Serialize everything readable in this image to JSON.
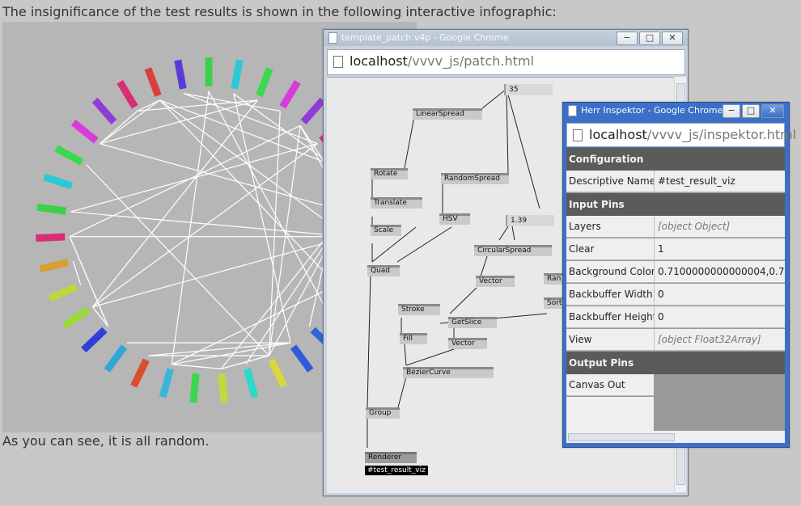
{
  "page": {
    "intro_text": "The insignificance of the test results is shown in the following interactive infographic:",
    "outro_text": "As you can see, it is all random."
  },
  "colors": {
    "page_bg": "#c8c8c8",
    "infographic_bg": "#b6b6b6",
    "bar_colors": [
      "#3cd14a",
      "#2bc8d8",
      "#3bd94c",
      "#d83bd8",
      "#8f3bd8",
      "#d82e79",
      "#d84040",
      "#5a3bd8",
      "#d8cf3b",
      "#d82e6b",
      "#2f3dd8",
      "#2ed8c8",
      "#2fd8c8",
      "#2f67d8",
      "#2f5bd8",
      "#d8d83b",
      "#2fd8c8",
      "#c3d83b",
      "#3bd84f",
      "#3bb6d8",
      "#d84f2f",
      "#2fa7d8",
      "#2f3fd8",
      "#9cd83b",
      "#bdd83b",
      "#d8a02f",
      "#d82e79"
    ],
    "inspektor_titlebar": "#3c6fc8",
    "section_header": "#5b5b5b"
  },
  "patch_window": {
    "title": "template_patch.v4p - Google Chrome",
    "url_host": "localhost",
    "url_path": "/vvvv_js/patch.html",
    "buttons": {
      "minimize": "−",
      "maximize": "□",
      "close": "✕"
    },
    "nodes": {
      "n35": "35",
      "linearspread": "LinearSpread",
      "rotate": "Rotate",
      "randomspread": "RandomSpread",
      "translate": "Translate",
      "hsv": "HSV",
      "n139": "1.39",
      "scale": "Scale",
      "circularspread": "CircularSpread",
      "quad": "Quad",
      "vector1": "Vector",
      "random": "Ran",
      "sort": "Sort",
      "stroke": "Stroke",
      "getslice": "GetSlice",
      "fill": "Fill",
      "vector2": "Vector",
      "beziercurve": "BezierCurve",
      "group": "Group",
      "renderer": "Renderer",
      "renderer_label": "#test_result_viz"
    }
  },
  "inspektor_window": {
    "title": "Herr Inspektor - Google Chrome",
    "url_host": "localhost",
    "url_path": "/vvvv_js/inspektor.html",
    "buttons": {
      "minimize": "−",
      "maximize": "□",
      "close": "✕"
    },
    "configuration_header": "Configuration",
    "descriptive_name_label": "Descriptive Name",
    "descriptive_name_value": "#test_result_viz",
    "input_pins_header": "Input Pins",
    "input_pins": [
      {
        "label": "Layers",
        "value": "[object Object]"
      },
      {
        "label": "Clear",
        "value": "1"
      },
      {
        "label": "Background Color",
        "value": "0.7100000000000004,0.7"
      },
      {
        "label": "Backbuffer Width",
        "value": "0"
      },
      {
        "label": "Backbuffer Height",
        "value": "0"
      },
      {
        "label": "View",
        "value": "[object Float32Array]"
      }
    ],
    "output_pins_header": "Output Pins",
    "output_pins": [
      {
        "label": "Canvas Out",
        "value": ""
      }
    ]
  }
}
